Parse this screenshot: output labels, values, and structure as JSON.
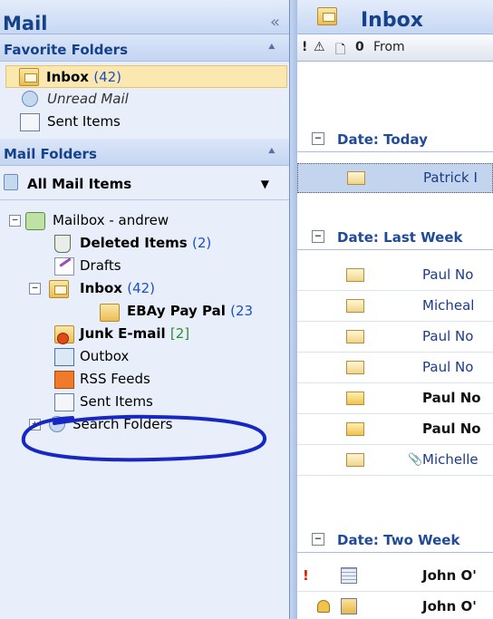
{
  "nav": {
    "title": "Mail",
    "collapse_glyph": "«",
    "favorite_header": "Favorite Folders",
    "favorites": [
      {
        "label": "Inbox",
        "count": "(42)",
        "icon": "inbox-folder-icon"
      },
      {
        "label": "Unread Mail",
        "icon": "search-folder-icon"
      },
      {
        "label": "Sent Items",
        "icon": "sent-items-icon"
      }
    ],
    "mail_folders_header": "Mail Folders",
    "all_mail_items": "All Mail Items",
    "tree": {
      "mailbox": "Mailbox - andrew",
      "deleted": {
        "label": "Deleted Items",
        "count": "(2)"
      },
      "drafts": "Drafts",
      "inbox": {
        "label": "Inbox",
        "count": "(42)"
      },
      "subfolder": {
        "label": "EBAy Pay Pal",
        "count": "(23"
      },
      "junk": {
        "label": "Junk E-mail",
        "count": "[2]"
      },
      "outbox": "Outbox",
      "rss": "RSS Feeds",
      "sent": "Sent Items",
      "search": "Search Folders"
    }
  },
  "list": {
    "title": "Inbox",
    "columns": {
      "importance": "!",
      "reminder": "⚠",
      "type": "🗋",
      "attachment": "0",
      "from": "From"
    },
    "groups": [
      {
        "label": "Date: Today"
      },
      {
        "label": "Date: Last Week"
      },
      {
        "label": "Date: Two Week"
      }
    ],
    "today": [
      {
        "from": "Patrick I"
      }
    ],
    "last_week": [
      {
        "from": "Paul No"
      },
      {
        "from": "Micheal"
      },
      {
        "from": "Paul No"
      },
      {
        "from": "Paul No"
      },
      {
        "from": "Paul No"
      },
      {
        "from": "Paul No"
      },
      {
        "from": "Michelle"
      }
    ],
    "two_weeks": [
      {
        "from": "John O'"
      },
      {
        "from": "John O'"
      }
    ]
  },
  "annotation_color": "#1727c4"
}
